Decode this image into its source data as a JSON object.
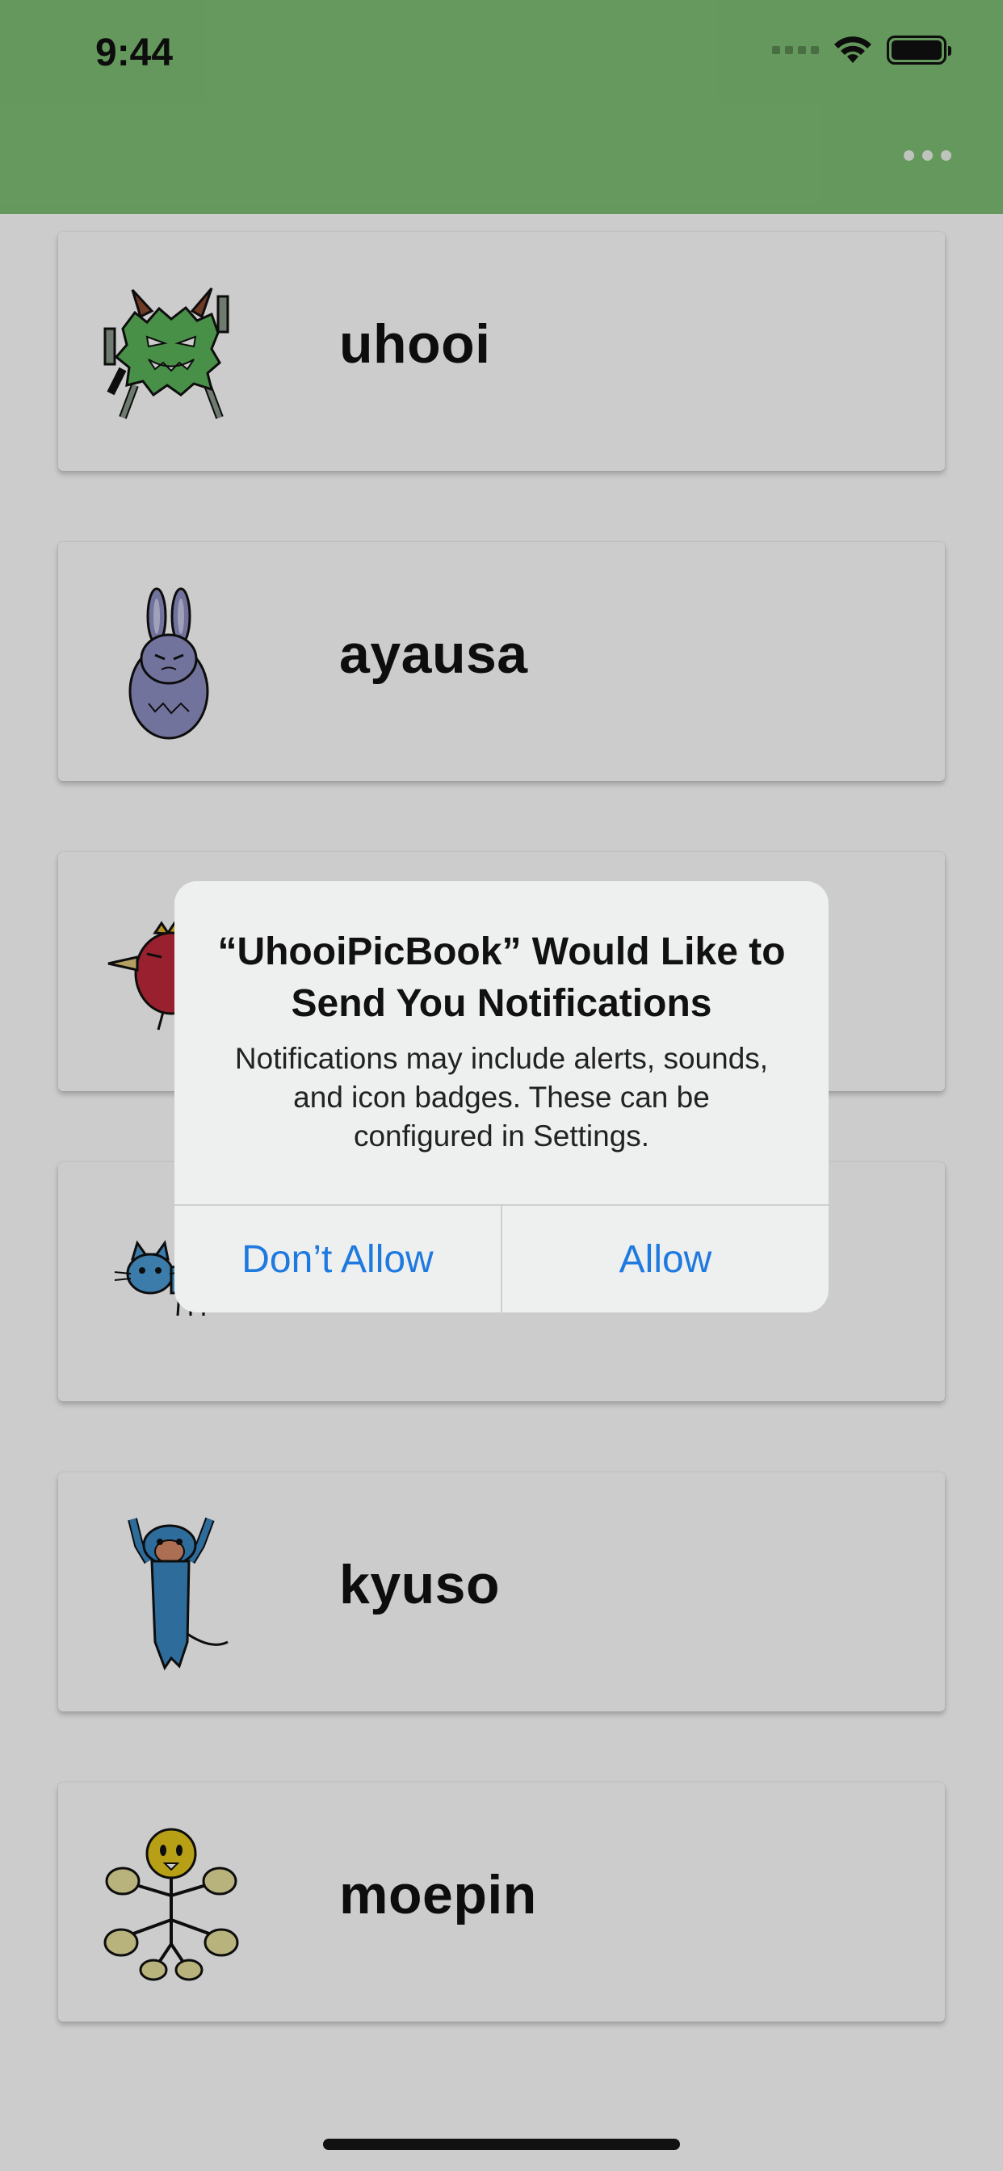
{
  "status_bar": {
    "time": "9:44"
  },
  "header": {
    "color": "#7fbf74",
    "more_icon": "more-horizontal-icon"
  },
  "characters": [
    {
      "name": "uhooi",
      "icon": "green-monster-icon"
    },
    {
      "name": "ayausa",
      "icon": "purple-rabbit-icon"
    },
    {
      "name": "",
      "icon": "red-bird-icon"
    },
    {
      "name": "",
      "icon": "blue-cat-icon"
    },
    {
      "name": "kyuso",
      "icon": "blue-creature-icon"
    },
    {
      "name": "moepin",
      "icon": "yellow-flower-creature-icon"
    }
  ],
  "alert": {
    "title": "“UhooiPicBook” Would Like to Send You Notifications",
    "message": "Notifications may include alerts, sounds, and icon badges. These can be configured in Settings.",
    "dont_allow_label": "Don’t Allow",
    "allow_label": "Allow",
    "button_color": "#1f7ae0"
  }
}
